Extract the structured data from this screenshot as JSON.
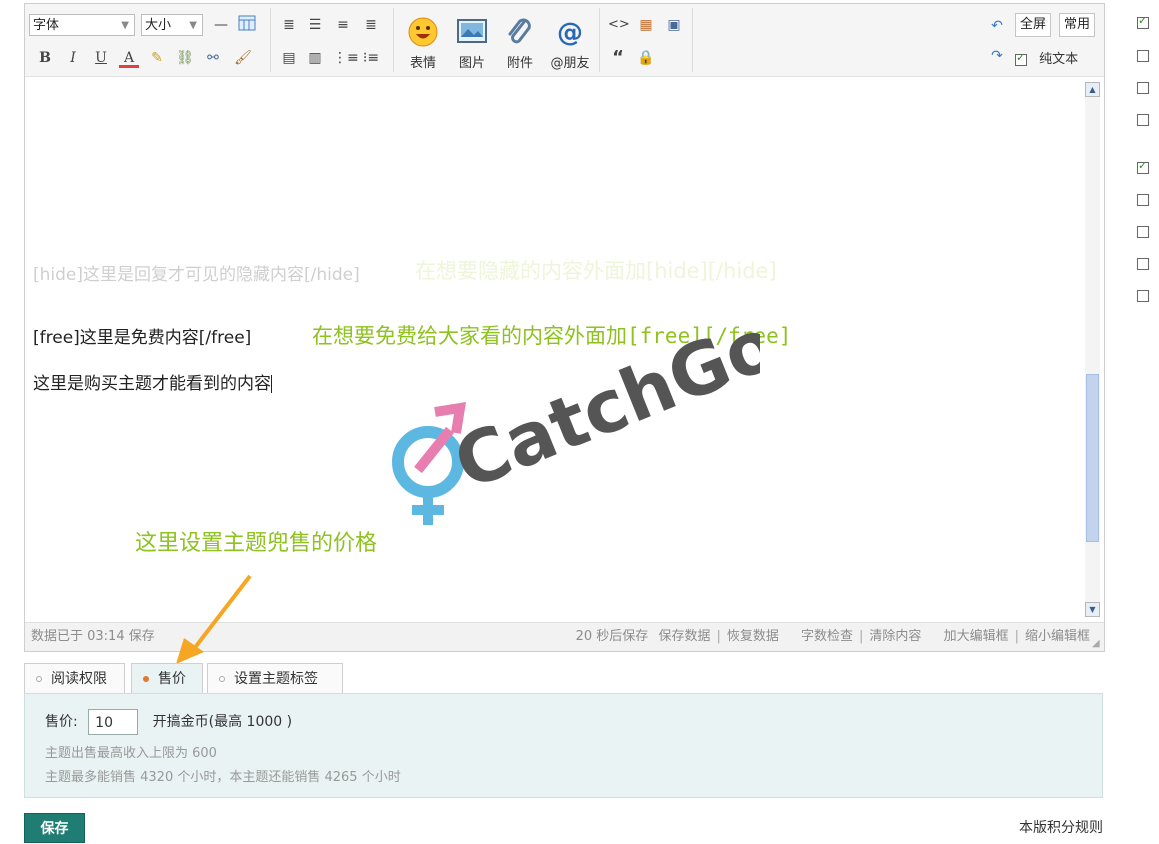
{
  "toolbar": {
    "font_select": "字体",
    "size_select": "大小",
    "big_buttons": [
      "表情",
      "图片",
      "附件",
      "@朋友"
    ],
    "fullscreen_label": "全屏",
    "common_label": "常用",
    "plaintext_label": "纯文本",
    "bold": "B",
    "italic": "I",
    "underline": "U",
    "font_color": "A",
    "code_glyph": "<>",
    "quote_glyph": "“"
  },
  "content": {
    "ghost_line": "[hide]这里是回复才可见的隐藏内容[/hide]",
    "ghost_annotation": "在想要隐藏的内容外面加[hide][/hide]",
    "free_line": "[free]这里是免费内容[/free]",
    "free_annotation_prefix": "在想要免费给大家看的内容外面加",
    "free_annotation_code": "[free][/free]",
    "paid_line": "这里是购买主题才能看到的内容",
    "price_annotation": "这里设置主题兜售的价格",
    "watermark_text": "CatchGod"
  },
  "status": {
    "saved_text": "数据已于 03:14 保存",
    "autosave_text": "20 秒后保存",
    "save_data": "保存数据",
    "restore_data": "恢复数据",
    "word_check": "字数检查",
    "clear_content": "清除内容",
    "enlarge_editor": "加大编辑框",
    "shrink_editor": "缩小编辑框"
  },
  "tabs": [
    "阅读权限",
    "售价",
    "设置主题标签"
  ],
  "active_tab": "售价",
  "price_panel": {
    "label": "售价:",
    "value": "10",
    "currency": "开搞金币(最高 1000 )",
    "hint1": "主题出售最高收入上限为 600",
    "hint2": "主题最多能销售 4320 个小时，本主题还能销售 4265 个小时"
  },
  "save_button": "保存",
  "rules_link": "本版积分规则",
  "sidebar_checkboxes": [
    true,
    false,
    false,
    false,
    true,
    false,
    false,
    false,
    false
  ],
  "colors": {
    "annotation_green": "#8dc21f",
    "save_button": "#1f7d73",
    "panel_bg": "#e9f3f3",
    "arrow_orange": "#f5a623",
    "watermark_gray": "#555555",
    "watermark_pink": "#e87db0",
    "watermark_blue": "#5cb8e0"
  }
}
